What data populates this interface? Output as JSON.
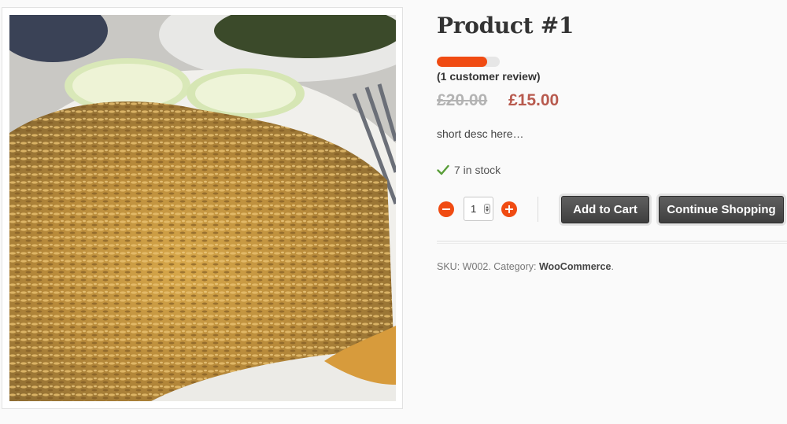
{
  "product": {
    "title": "Product #1",
    "rating_fraction": 0.8,
    "review_text": "(1 customer review)",
    "price_old": "£20.00",
    "price_new": "£15.00",
    "short_desc": "short desc here…",
    "stock_text": "7 in stock",
    "quantity": "1"
  },
  "actions": {
    "add_to_cart": "Add to Cart",
    "continue_shopping": "Continue Shopping"
  },
  "meta": {
    "sku_label": "SKU:",
    "sku_value": "W002",
    "category_label": "Category:",
    "category_value": "WooCommerce"
  },
  "colors": {
    "accent": "#f04b12",
    "sale_price": "#b85a4e",
    "check": "#5a9e3a",
    "button": "#4a4a4a"
  },
  "icons": {
    "minus": "minus-circle-icon",
    "plus": "plus-circle-icon",
    "check": "check-icon"
  }
}
